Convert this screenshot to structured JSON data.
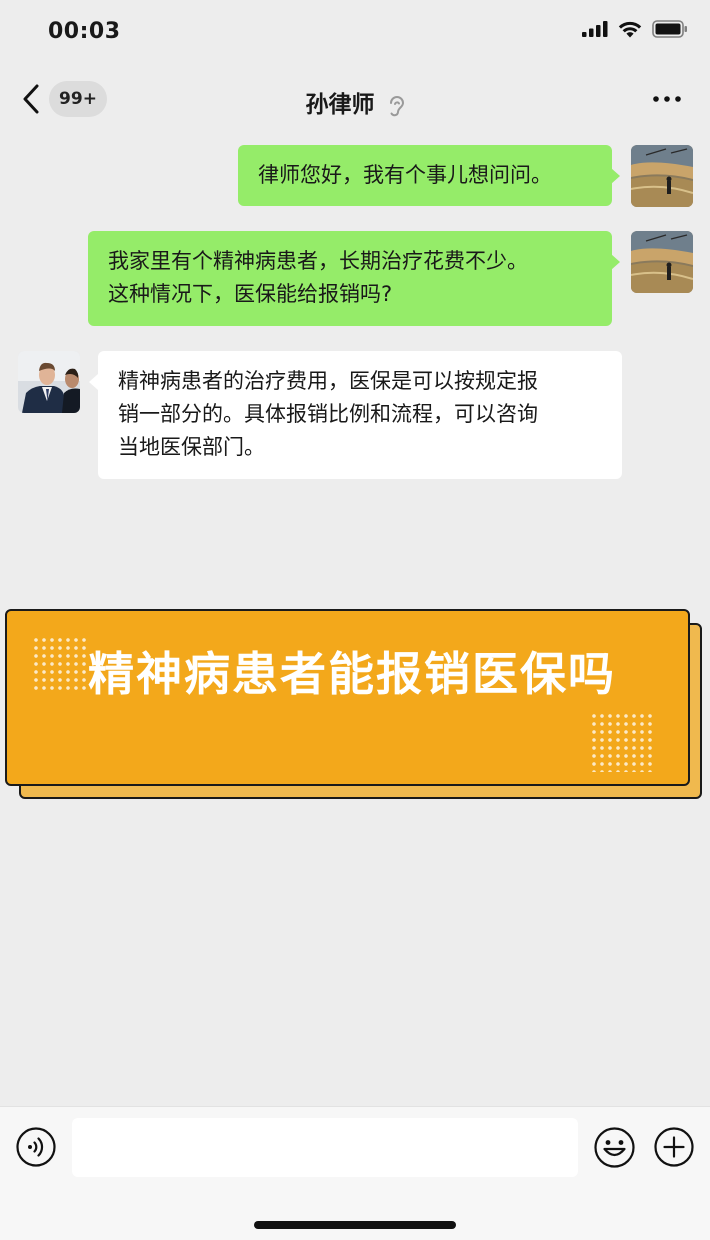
{
  "status_bar": {
    "time": "00:03"
  },
  "header": {
    "unread_badge": "99+",
    "title": "孙律师"
  },
  "messages": [
    {
      "sender": "me",
      "text": "律师您好，我有个事儿想问问。"
    },
    {
      "sender": "me",
      "lines": [
        "我家里有个精神病患者，长期治疗花费不少。",
        "这种情况下，医保能给报销吗?"
      ]
    },
    {
      "sender": "lawyer",
      "lines": [
        "精神病患者的治疗费用，医保是可以按规定报",
        "销一部分的。具体报销比例和流程，可以咨询",
        "当地医保部门。"
      ]
    }
  ],
  "banner": {
    "text": "精神病患者能报销医保吗"
  },
  "input_bar": {
    "value": "",
    "placeholder": ""
  },
  "colors": {
    "my_bubble": "#95ec69",
    "other_bubble": "#ffffff",
    "banner_fill": "#f3a81b",
    "background": "#ededed"
  },
  "icons": [
    "back-arrow-icon",
    "hearing-icon",
    "more-dots-icon",
    "voice-icon",
    "emoji-icon",
    "plus-icon",
    "signal-icon",
    "wifi-icon",
    "battery-icon"
  ]
}
